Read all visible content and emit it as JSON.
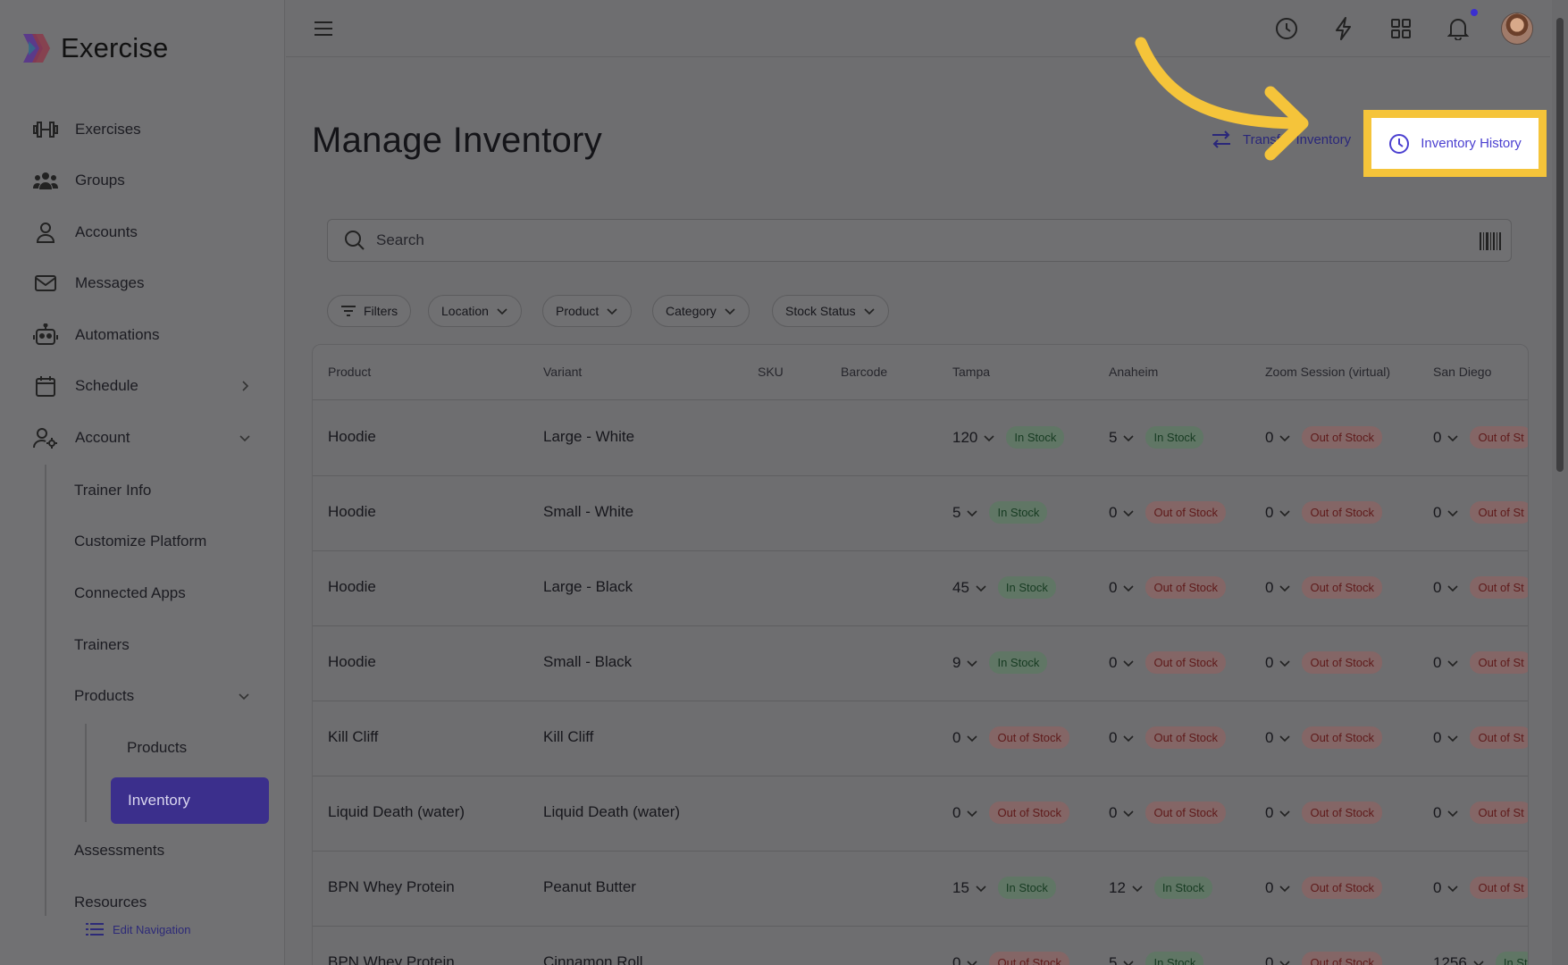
{
  "brand": {
    "name": "Exercise"
  },
  "sidebar": {
    "items": [
      {
        "label": "Exercises",
        "icon": "dumbbell-icon"
      },
      {
        "label": "Groups",
        "icon": "users-icon"
      },
      {
        "label": "Accounts",
        "icon": "user-icon"
      },
      {
        "label": "Messages",
        "icon": "mail-icon"
      },
      {
        "label": "Automations",
        "icon": "robot-icon"
      },
      {
        "label": "Schedule",
        "icon": "calendar-icon"
      },
      {
        "label": "Account",
        "icon": "user-gear-icon"
      }
    ],
    "account_sub": [
      "Trainer Info",
      "Customize Platform",
      "Connected Apps",
      "Trainers",
      "Products"
    ],
    "products_sub": [
      "Products",
      "Inventory"
    ],
    "more_sub": [
      "Assessments",
      "Resources"
    ],
    "edit_nav": "Edit Navigation"
  },
  "header": {
    "title": "Manage Inventory",
    "transfer_label": "Transfer Inventory",
    "history_label": "Inventory History"
  },
  "search": {
    "placeholder": "Search"
  },
  "filters": [
    "Filters",
    "Location",
    "Product",
    "Category",
    "Stock Status"
  ],
  "table": {
    "columns": [
      "Product",
      "Variant",
      "SKU",
      "Barcode",
      "Tampa",
      "Anaheim",
      "Zoom Session (virtual)",
      "San Diego"
    ],
    "rows": [
      {
        "product": "Hoodie",
        "variant": "Large - White",
        "stock": [
          [
            "120",
            "In Stock"
          ],
          [
            "5",
            "In Stock"
          ],
          [
            "0",
            "Out of Stock"
          ],
          [
            "0",
            "Out of St"
          ]
        ]
      },
      {
        "product": "Hoodie",
        "variant": "Small - White",
        "stock": [
          [
            "5",
            "In Stock"
          ],
          [
            "0",
            "Out of Stock"
          ],
          [
            "0",
            "Out of Stock"
          ],
          [
            "0",
            "Out of St"
          ]
        ]
      },
      {
        "product": "Hoodie",
        "variant": "Large - Black",
        "stock": [
          [
            "45",
            "In Stock"
          ],
          [
            "0",
            "Out of Stock"
          ],
          [
            "0",
            "Out of Stock"
          ],
          [
            "0",
            "Out of St"
          ]
        ]
      },
      {
        "product": "Hoodie",
        "variant": "Small - Black",
        "stock": [
          [
            "9",
            "In Stock"
          ],
          [
            "0",
            "Out of Stock"
          ],
          [
            "0",
            "Out of Stock"
          ],
          [
            "0",
            "Out of St"
          ]
        ]
      },
      {
        "product": "Kill Cliff",
        "variant": "Kill Cliff",
        "stock": [
          [
            "0",
            "Out of Stock"
          ],
          [
            "0",
            "Out of Stock"
          ],
          [
            "0",
            "Out of Stock"
          ],
          [
            "0",
            "Out of St"
          ]
        ]
      },
      {
        "product": "Liquid Death (water)",
        "variant": "Liquid Death (water)",
        "stock": [
          [
            "0",
            "Out of Stock"
          ],
          [
            "0",
            "Out of Stock"
          ],
          [
            "0",
            "Out of Stock"
          ],
          [
            "0",
            "Out of St"
          ]
        ]
      },
      {
        "product": "BPN Whey Protein",
        "variant": "Peanut Butter",
        "stock": [
          [
            "15",
            "In Stock"
          ],
          [
            "12",
            "In Stock"
          ],
          [
            "0",
            "Out of Stock"
          ],
          [
            "0",
            "Out of St"
          ]
        ]
      },
      {
        "product": "BPN Whey Protein",
        "variant": "Cinnamon Roll",
        "stock": [
          [
            "0",
            "Out of Stock"
          ],
          [
            "5",
            "In Stock"
          ],
          [
            "0",
            "Out of Stock"
          ],
          [
            "1256",
            "In St"
          ]
        ]
      }
    ]
  },
  "colors": {
    "accent": "#3b2f8c",
    "highlight": "#f5c43a",
    "link": "#4a3fd0"
  }
}
